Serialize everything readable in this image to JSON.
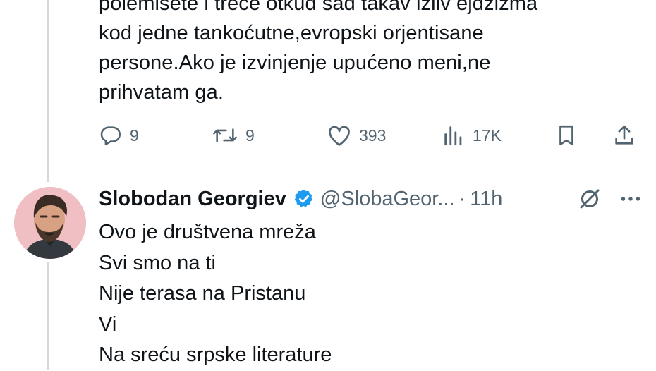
{
  "previous_tweet": {
    "text_lines": [
      "polemišete i treće otkud sad takav izliv ejdžizma",
      "kod jedne tankoćutne,evropski orjentisane",
      "persone.Ako je izvinjenje upućeno meni,ne",
      "prihvatam ga."
    ],
    "actions": {
      "replies": "9",
      "reposts": "9",
      "likes": "393",
      "views": "17K"
    },
    "icons": [
      "reply-icon",
      "repost-icon",
      "like-icon",
      "views-icon",
      "bookmark-icon",
      "share-icon"
    ]
  },
  "reply_tweet": {
    "author_name": "Slobodan Georgiev",
    "handle": "@SlobaGeor...",
    "separator": "·",
    "time": "11h",
    "verified_color": "#1d9bf0",
    "text_lines": [
      "Ovo je društvena mreža",
      "Svi smo na ti",
      "Nije terasa na Pristanu",
      "Vi",
      "Na sreću srpske literature"
    ],
    "icons": [
      "grok-icon",
      "more-icon"
    ]
  },
  "colors": {
    "text": "#0f1419",
    "secondary": "#536471",
    "thread_line": "#cfd9de",
    "avatar_bg": "#f0bfc3"
  }
}
